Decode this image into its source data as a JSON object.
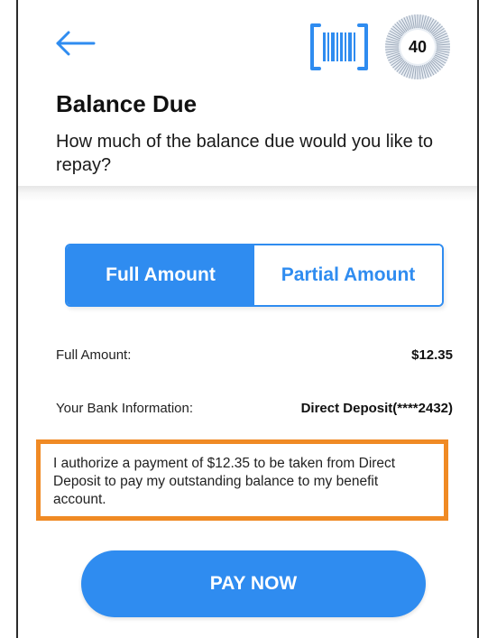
{
  "header": {
    "back_icon": "back-arrow-icon",
    "barcode_icon": "barcode-scan-icon",
    "timer_value": "40",
    "accent_color": "#2f8cf0"
  },
  "page": {
    "title": "Balance Due",
    "subtitle": "How much of the balance due would you like to repay?"
  },
  "segmented_control": {
    "options": [
      {
        "label": "Full Amount",
        "selected": true
      },
      {
        "label": "Partial Amount",
        "selected": false
      }
    ]
  },
  "details": {
    "full_amount_label": "Full Amount:",
    "full_amount_value": "$12.35",
    "bank_label": "Your Bank Information:",
    "bank_value": "Direct Deposit(****2432)"
  },
  "authorization": {
    "text": "I authorize a payment of $12.35 to be taken from Direct Deposit to pay my outstanding balance to my benefit account.",
    "highlight_color": "#f08a24"
  },
  "actions": {
    "pay_now_label": "PAY NOW"
  }
}
